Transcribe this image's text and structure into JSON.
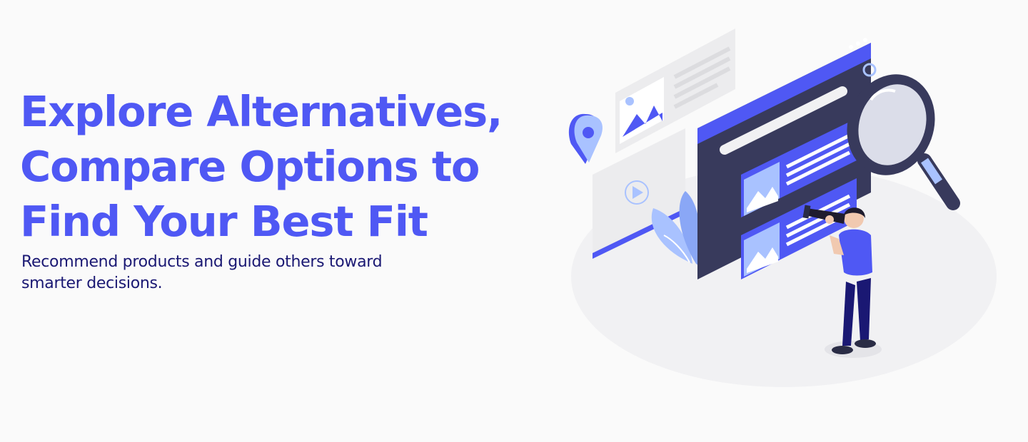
{
  "hero": {
    "headline_lines": [
      "Explore Alternatives,",
      "Compare Options to",
      "Find Your Best Fit"
    ],
    "subtitle": "Recommend products and guide others toward smarter decisions."
  },
  "illustration": {
    "icon": "person-with-telescope-and-magnifier-illustration"
  },
  "colors": {
    "accent": "#4f58f4",
    "navy": "#1a1873",
    "dark_panel": "#383a5c",
    "light_blue": "#a9c2ff",
    "background": "#fafafa"
  }
}
